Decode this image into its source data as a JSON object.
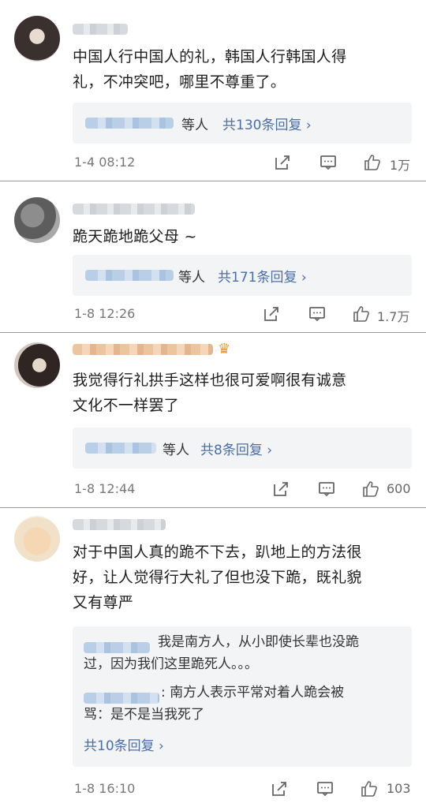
{
  "comments": [
    {
      "text": "中国人行中国人的礼，韩国人行韩国人得\n礼，不冲突吧，哪里不尊重了。",
      "reply_suffix": "等人",
      "reply_more": "共130条回复 ›",
      "time": "1-4 08:12",
      "likes": "1万"
    },
    {
      "text": "跪天跪地跪父母 ~",
      "reply_suffix": "等人",
      "reply_more": "共171条回复 ›",
      "time": "1-8 12:26",
      "likes": "1.7万"
    },
    {
      "text": "我觉得行礼拱手这样也很可爱啊很有诚意\n文化不一样罢了",
      "reply_suffix": "等人",
      "reply_more": "共8条回复 ›",
      "time": "1-8 12:44",
      "likes": "600"
    },
    {
      "text": "对于中国人真的跪不下去，趴地上的方法很\n好，让人觉得行大礼了但也没下跪，既礼貌\n又有尊严",
      "nested_1": "我是南方人，从小即使长辈也没跪\n过，因为我们这里跪死人。。。",
      "nested_2": ": 南方人表示平常对着人跪会被\n骂：是不是当我死了",
      "reply_more": "共10条回复 ›",
      "time": "1-8 16:10",
      "likes": "103"
    }
  ]
}
